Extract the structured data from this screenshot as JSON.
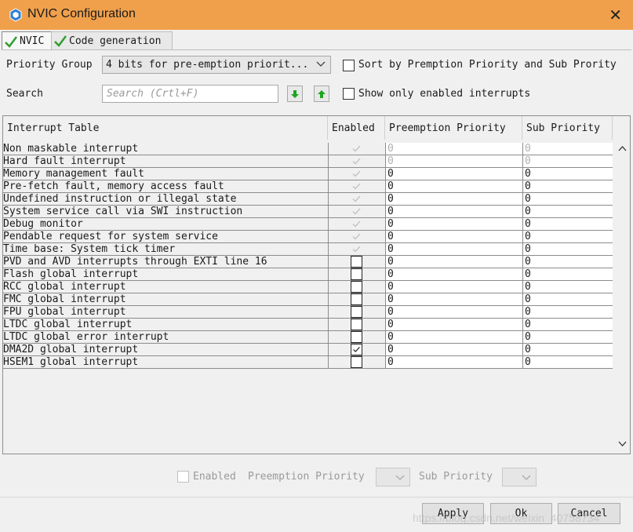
{
  "window": {
    "title": "NVIC Configuration"
  },
  "tabs": [
    {
      "label": "NVIC",
      "active": true
    },
    {
      "label": "Code generation",
      "active": false
    }
  ],
  "controls": {
    "priority_group_label": "Priority Group",
    "priority_group_value": "4 bits for pre-emption priorit...",
    "sort_label": "Sort by Premption Priority and Sub Prority",
    "search_label": "Search",
    "search_placeholder": "Search (Crtl+F)",
    "show_enabled_label": "Show only enabled interrupts"
  },
  "table": {
    "headers": [
      "Interrupt Table",
      "Enabled",
      "Preemption Priority",
      "Sub Priority"
    ],
    "rows": [
      {
        "name": "Non maskable interrupt",
        "enabled": "locked",
        "preemption": "0",
        "sub": "0",
        "disabled": true
      },
      {
        "name": "Hard fault interrupt",
        "enabled": "locked",
        "preemption": "0",
        "sub": "0",
        "disabled": true
      },
      {
        "name": "Memory management fault",
        "enabled": "locked",
        "preemption": "0",
        "sub": "0",
        "disabled": false
      },
      {
        "name": "Pre-fetch fault, memory access fault",
        "enabled": "locked",
        "preemption": "0",
        "sub": "0",
        "disabled": false
      },
      {
        "name": "Undefined instruction or illegal state",
        "enabled": "locked",
        "preemption": "0",
        "sub": "0",
        "disabled": false
      },
      {
        "name": "System service call via SWI instruction",
        "enabled": "locked",
        "preemption": "0",
        "sub": "0",
        "disabled": false
      },
      {
        "name": "Debug monitor",
        "enabled": "locked",
        "preemption": "0",
        "sub": "0",
        "disabled": false
      },
      {
        "name": "Pendable request for system service",
        "enabled": "locked",
        "preemption": "0",
        "sub": "0",
        "disabled": false
      },
      {
        "name": "Time base: System tick timer",
        "enabled": "locked",
        "preemption": "0",
        "sub": "0",
        "disabled": false
      },
      {
        "name": "PVD and AVD interrupts through EXTI line 16",
        "enabled": "off",
        "preemption": "0",
        "sub": "0",
        "disabled": false
      },
      {
        "name": "Flash global interrupt",
        "enabled": "off",
        "preemption": "0",
        "sub": "0",
        "disabled": false
      },
      {
        "name": "RCC global interrupt",
        "enabled": "off",
        "preemption": "0",
        "sub": "0",
        "disabled": false
      },
      {
        "name": "FMC global interrupt",
        "enabled": "off",
        "preemption": "0",
        "sub": "0",
        "disabled": false
      },
      {
        "name": "FPU global interrupt",
        "enabled": "off",
        "preemption": "0",
        "sub": "0",
        "disabled": false
      },
      {
        "name": "LTDC global interrupt",
        "enabled": "off",
        "preemption": "0",
        "sub": "0",
        "disabled": false
      },
      {
        "name": "LTDC global error interrupt",
        "enabled": "off",
        "preemption": "0",
        "sub": "0",
        "disabled": false
      },
      {
        "name": "DMA2D global interrupt",
        "enabled": "on",
        "preemption": "0",
        "sub": "0",
        "disabled": false
      },
      {
        "name": "HSEM1 global interrupt",
        "enabled": "off",
        "preemption": "0",
        "sub": "0",
        "disabled": false
      }
    ]
  },
  "bottom": {
    "enabled_label": "Enabled",
    "preemption_label": "Preemption Priority",
    "sub_label": "Sub Priority"
  },
  "buttons": {
    "apply": "Apply",
    "ok": "Ok",
    "cancel": "Cancel"
  },
  "watermark": "https://blog.csdn.net/weixin_40758734",
  "colors": {
    "titlebar": "#f0a04b",
    "check_green": "#2e9e2e",
    "arrow_green": "#1fa51f"
  }
}
